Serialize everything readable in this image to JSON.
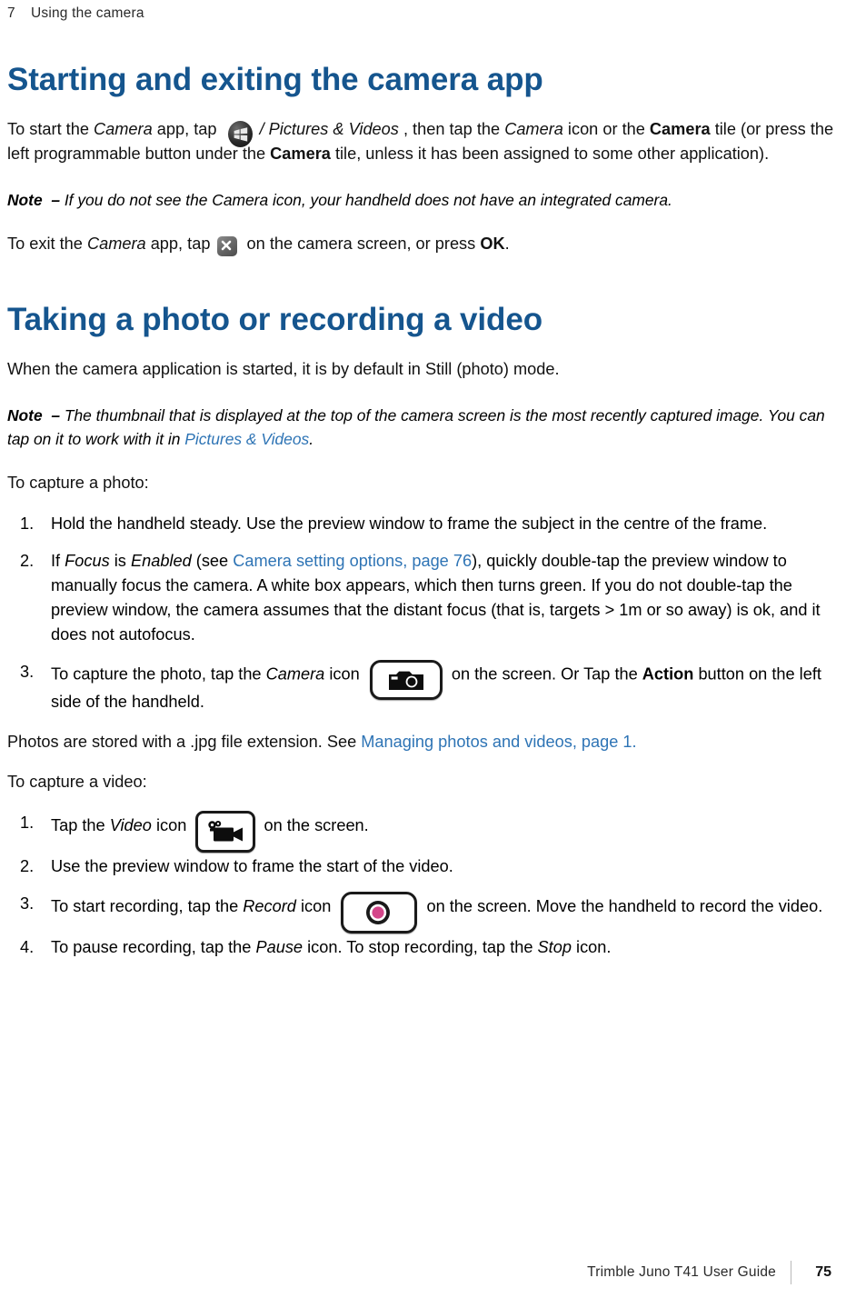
{
  "header": {
    "chapter_number": "7",
    "chapter_title": "Using the camera"
  },
  "sections": [
    {
      "heading": "Starting and exiting the camera app",
      "intro_1a": "To start the ",
      "intro_1b": "Camera",
      "intro_1c": " app, tap ",
      "intro_1d": "/ Pictures & Videos",
      "intro_1e": " , then tap the ",
      "intro_1f": "Camera",
      "intro_1g": " icon or the ",
      "intro_1h": "Camera",
      "intro_1i": " tile (or press the left programmable button under the ",
      "intro_1j": "Camera",
      "intro_1k": " tile, unless it has been assigned to some other application).",
      "note_label": "Note",
      "note_dash": "–",
      "note_text": "If you do not see the Camera icon, your handheld does not have an integrated camera.",
      "exit_a": "To exit the ",
      "exit_b": "Camera",
      "exit_c": " app, tap ",
      "exit_d": " on the camera screen, or press ",
      "exit_e": "OK",
      "exit_f": "."
    },
    {
      "heading": "Taking a photo or recording a video",
      "intro": "When the camera application is started, it is by default in Still (photo) mode.",
      "note_label": "Note",
      "note_dash": "–",
      "note_text_a": "The thumbnail that is displayed at the top of the camera screen is the most recently captured image. You can tap on it to work with it in ",
      "note_link": "Pictures & Videos",
      "note_text_b": ".",
      "photo_lead": "To capture a photo:",
      "photo_steps": [
        {
          "num": "1.",
          "text": "Hold the handheld steady. Use the preview window to frame the subject in the centre of the frame."
        },
        {
          "num": "2.",
          "a": "If ",
          "b": "Focus",
          "c": " is ",
          "d": "Enabled",
          "e": " (see ",
          "link": "Camera setting options, page 76",
          "f": "), quickly double-tap the preview window to manually focus the camera. A white box appears, which then turns green. If you do not double-tap the preview window, the camera assumes that the distant focus (that is, targets > 1m or so away) is ok, and it does not autofocus."
        },
        {
          "num": "3.",
          "a": "To capture the photo, tap the ",
          "b": "Camera",
          "c": " icon ",
          "d": " on the screen. Or Tap the ",
          "e": "Action",
          "f": " button on the left side of the handheld."
        }
      ],
      "stored_a": "Photos are stored with a .jpg file extension. See ",
      "stored_link": "Managing photos and videos, page 1.",
      "video_lead": "To capture a video:",
      "video_steps": [
        {
          "num": "1.",
          "a": "Tap the ",
          "b": "Video",
          "c": " icon ",
          "d": " on the screen."
        },
        {
          "num": "2.",
          "text": "Use the preview window to frame the start of the video."
        },
        {
          "num": "3.",
          "a": "To start recording, tap the ",
          "b": "Record",
          "c": " icon ",
          "d": " on the screen. Move the handheld to record the video."
        },
        {
          "num": "4.",
          "a": "To pause recording, tap the ",
          "b": "Pause",
          "c": " icon. To stop recording, tap the ",
          "d": "Stop",
          "e": " icon."
        }
      ]
    }
  ],
  "icons": {
    "start": "windows-start-icon",
    "close": "close-x-icon",
    "camera": "camera-icon",
    "video": "video-camera-icon",
    "record": "record-icon"
  },
  "footer": {
    "doc_title": "Trimble Juno T41 User Guide",
    "page_number": "75"
  },
  "colors": {
    "heading": "#15558E",
    "link": "#2E74B5",
    "record_dot": "#D4468A"
  }
}
